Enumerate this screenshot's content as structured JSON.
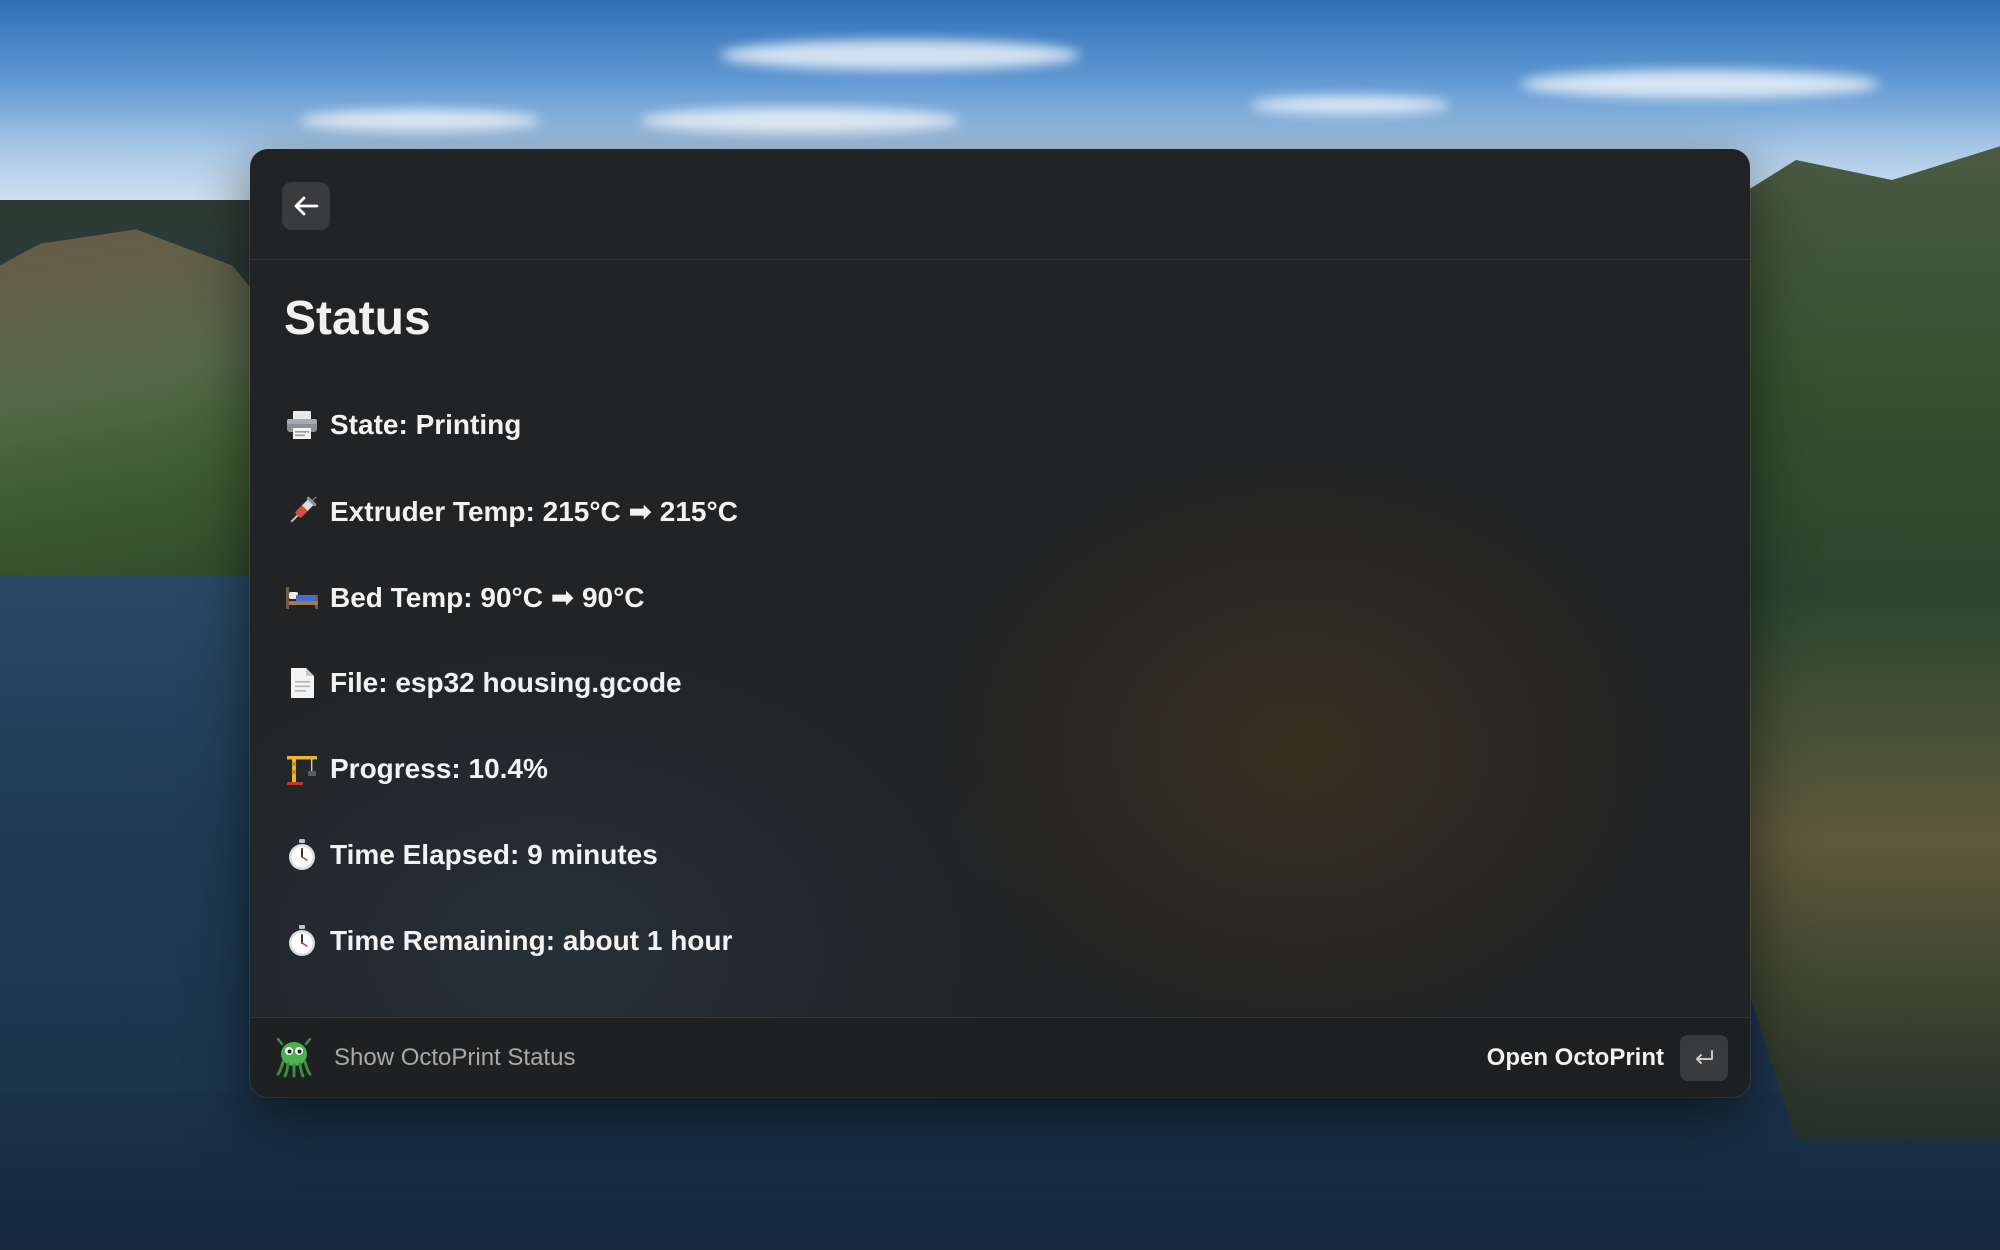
{
  "header": {
    "back_icon": "arrow-left-icon"
  },
  "main": {
    "title": "Status",
    "rows": [
      {
        "icon": "printer-icon",
        "text": "State: Printing"
      },
      {
        "icon": "syringe-icon",
        "text": "Extruder Temp: 215°C ➡ 215°C"
      },
      {
        "icon": "bed-icon",
        "text": "Bed Temp: 90°C ➡ 90°C"
      },
      {
        "icon": "document-icon",
        "text": "File: esp32 housing.gcode"
      },
      {
        "icon": "crane-icon",
        "text": "Progress: 10.4%"
      },
      {
        "icon": "stopwatch-icon",
        "text": "Time Elapsed: 9 minutes"
      },
      {
        "icon": "stopwatch-icon",
        "text": "Time Remaining: about 1 hour"
      }
    ]
  },
  "footer": {
    "command_title": "Show OctoPrint Status",
    "primary_action_label": "Open OctoPrint",
    "enter_key_icon": "return-key-icon"
  },
  "colors": {
    "window_bg": "#222324",
    "text": "#f2f2f2",
    "muted_text": "#a9a9a9",
    "key_bg": "#3a3b3d"
  }
}
